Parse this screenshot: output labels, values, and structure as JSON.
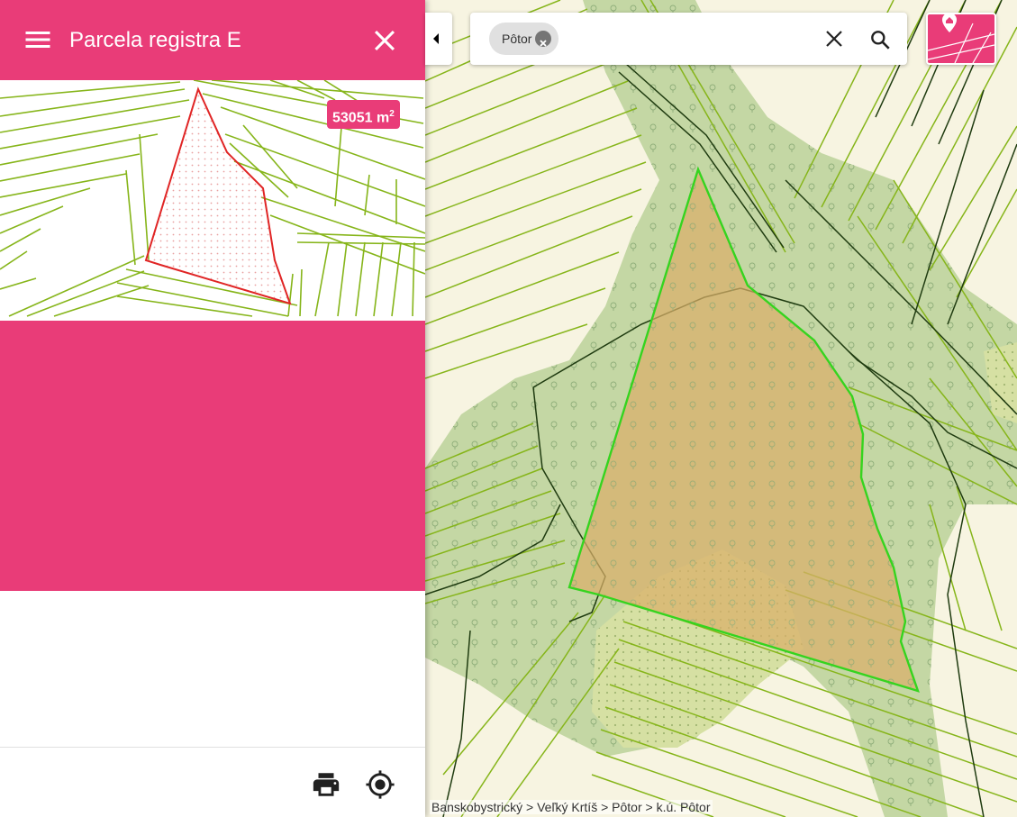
{
  "panel": {
    "title": "Parcela registra E",
    "area_value": "53051",
    "area_unit": "m",
    "area_exp": "2"
  },
  "search": {
    "chip_label": "Pôtor"
  },
  "breadcrumb": {
    "text": "Banskobystrický > Veľký Krtíš > Pôtor > k.ú. Pôtor"
  },
  "icons": {
    "menu": "menu-icon",
    "close": "close-icon",
    "print": "print-icon",
    "locate": "gps-fixed-icon",
    "collapse": "arrow-left-icon",
    "chip_remove": "cancel-icon",
    "clear": "close-icon",
    "search": "search-icon",
    "layers": "parcel-layer-icon"
  },
  "colors": {
    "accent": "#e93c78",
    "parcel_outline": "#35d41f",
    "thumb_parcel_outline": "#e02525",
    "parcel_lines": "#7fae12",
    "forest": "#c3d6a3",
    "parcel_fill": "#d9ae6a"
  }
}
